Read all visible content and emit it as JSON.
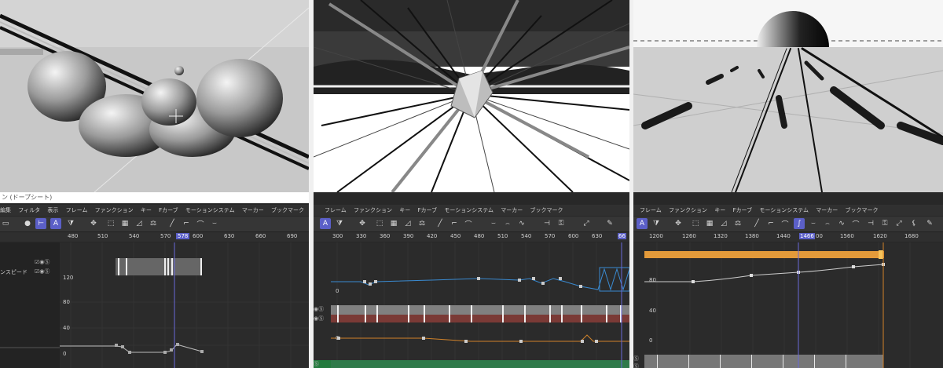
{
  "panel1": {
    "title": "ン (ドープシート)",
    "menu": [
      "編集",
      "フィルタ",
      "表示",
      "フレーム",
      "ファンクション",
      "キー",
      "Fカーブ",
      "モーションシステム",
      "マーカー",
      "ブックマーク"
    ],
    "ruler": [
      "480",
      "510",
      "540",
      "570",
      "600",
      "630",
      "660",
      "690"
    ],
    "current_frame": "578",
    "track_label": "ンスピード",
    "y_labels": [
      "120",
      "80",
      "40",
      "0"
    ]
  },
  "panel2": {
    "menu": [
      "フレーム",
      "ファンクション",
      "キー",
      "Fカーブ",
      "モーションシステム",
      "マーカー",
      "ブックマーク"
    ],
    "ruler": [
      "300",
      "330",
      "360",
      "390",
      "420",
      "450",
      "480",
      "510",
      "540",
      "570",
      "600",
      "630",
      "66"
    ],
    "y_labels": [
      "0",
      "0"
    ]
  },
  "panel3": {
    "menu": [
      "フレーム",
      "ファンクション",
      "キー",
      "Fカーブ",
      "モーションシステム",
      "マーカー",
      "ブックマーク"
    ],
    "ruler": [
      "1200",
      "1260",
      "1320",
      "1380",
      "1440",
      "00",
      "1560",
      "1620",
      "1680"
    ],
    "current_frame": "1466",
    "y_labels": [
      "80",
      "40",
      "0"
    ]
  },
  "colors": {
    "active_tool": "#5b5fc7",
    "playhead": "#6a6ad8",
    "curve_blue": "#3a8ad0",
    "curve_orange": "#d0822a",
    "bar_orange": "#e39a3a",
    "bar_red": "#7a3a36",
    "bar_green": "#2f7a4a"
  }
}
